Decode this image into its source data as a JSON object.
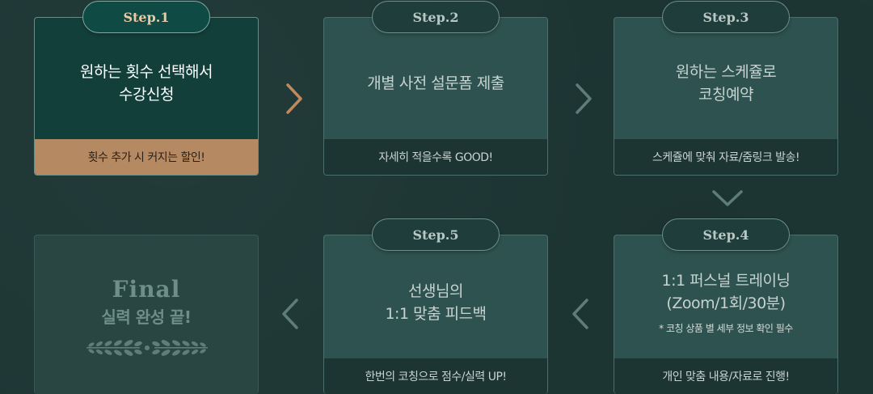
{
  "steps": [
    {
      "badge": "Step.1",
      "lines": [
        "원하는 횟수 선택해서",
        "수강신청"
      ],
      "footer": "횟수 추가 시 커지는 할인!"
    },
    {
      "badge": "Step.2",
      "lines": [
        "개별 사전 설문폼 제출"
      ],
      "footer": "자세히 적을수록 GOOD!"
    },
    {
      "badge": "Step.3",
      "lines": [
        "원하는 스케쥴로",
        "코칭예약"
      ],
      "footer": "스케쥴에 맞춰 자료/줌링크 발송!"
    },
    {
      "badge": "Step.4",
      "lines": [
        "1:1 퍼스널 트레이닝",
        "(Zoom/1회/30분)"
      ],
      "note": "* 코칭 상품 별 세부 정보 확인 필수",
      "footer": "개인 맞춤 내용/자료로 진행!"
    },
    {
      "badge": "Step.5",
      "lines": [
        "선생님의",
        "1:1 맞춤 피드백"
      ],
      "footer": "한번의 코칭으로 점수/실력 UP!"
    }
  ],
  "final": {
    "title": "Final",
    "subtitle": "실력 완성 끝!"
  },
  "icons": {
    "arrow_right": "chevron-right-icon",
    "arrow_left": "chevron-left-icon",
    "arrow_down": "chevron-down-icon",
    "laurel": "laurel-icon"
  },
  "colors": {
    "active_card": "#133f3b",
    "active_footer": "#b58a63",
    "active_arrow": "#c08a5c",
    "inactive_card": "#2e524f",
    "background": "#1d3634"
  }
}
